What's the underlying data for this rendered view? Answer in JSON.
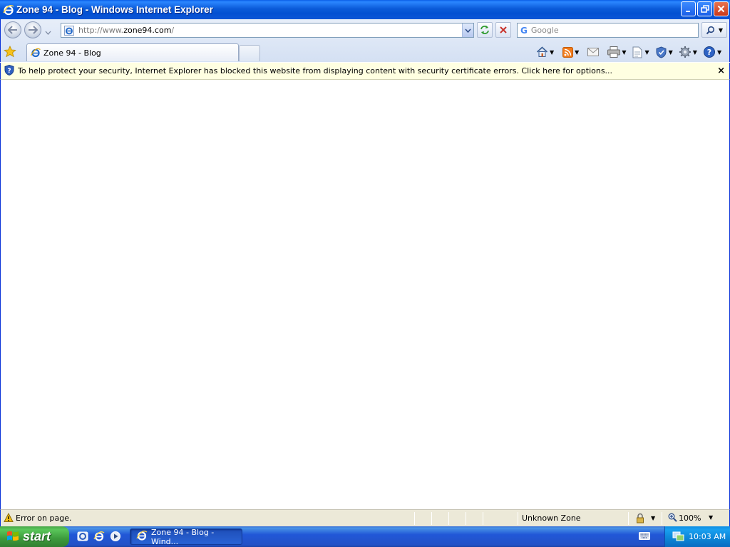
{
  "window": {
    "title": "Zone 94 - Blog - Windows Internet Explorer"
  },
  "toolbar": {
    "address_prefix": "http://www.",
    "address_domain": "zone94.com",
    "address_suffix": "/",
    "search_placeholder": "Google",
    "search_engine_letter": "G"
  },
  "tabs": [
    {
      "label": "Zone 94 - Blog",
      "active": true
    }
  ],
  "infobar": {
    "message": "To help protect your security, Internet Explorer has blocked this website from displaying content with security certificate errors. Click here for options...",
    "close_glyph": "×"
  },
  "statusbar": {
    "message": "Error on page.",
    "zone": "Unknown Zone",
    "zoom": "100%"
  },
  "taskbar": {
    "start_label": "start",
    "task_label": "Zone 94 - Blog - Wind...",
    "clock": "10:03 AM"
  },
  "colors": {
    "titlebar": "#0350d2",
    "infobar_bg": "#ffffe1",
    "taskbar": "#2157d7",
    "start": "#3c9a3c",
    "tray": "#0c84d6"
  },
  "icons": [
    "ie-icon",
    "back-icon",
    "forward-icon",
    "refresh-icon",
    "stop-icon",
    "search-icon",
    "favorites-star-icon",
    "home-icon",
    "rss-feed-icon",
    "read-mail-icon",
    "print-icon",
    "page-icon",
    "safety-icon",
    "tools-gear-icon",
    "help-icon",
    "shield-info-icon",
    "warning-icon",
    "lock-icon",
    "zoom-icon",
    "windows-flag-icon",
    "keyboard-icon",
    "network-icon"
  ]
}
